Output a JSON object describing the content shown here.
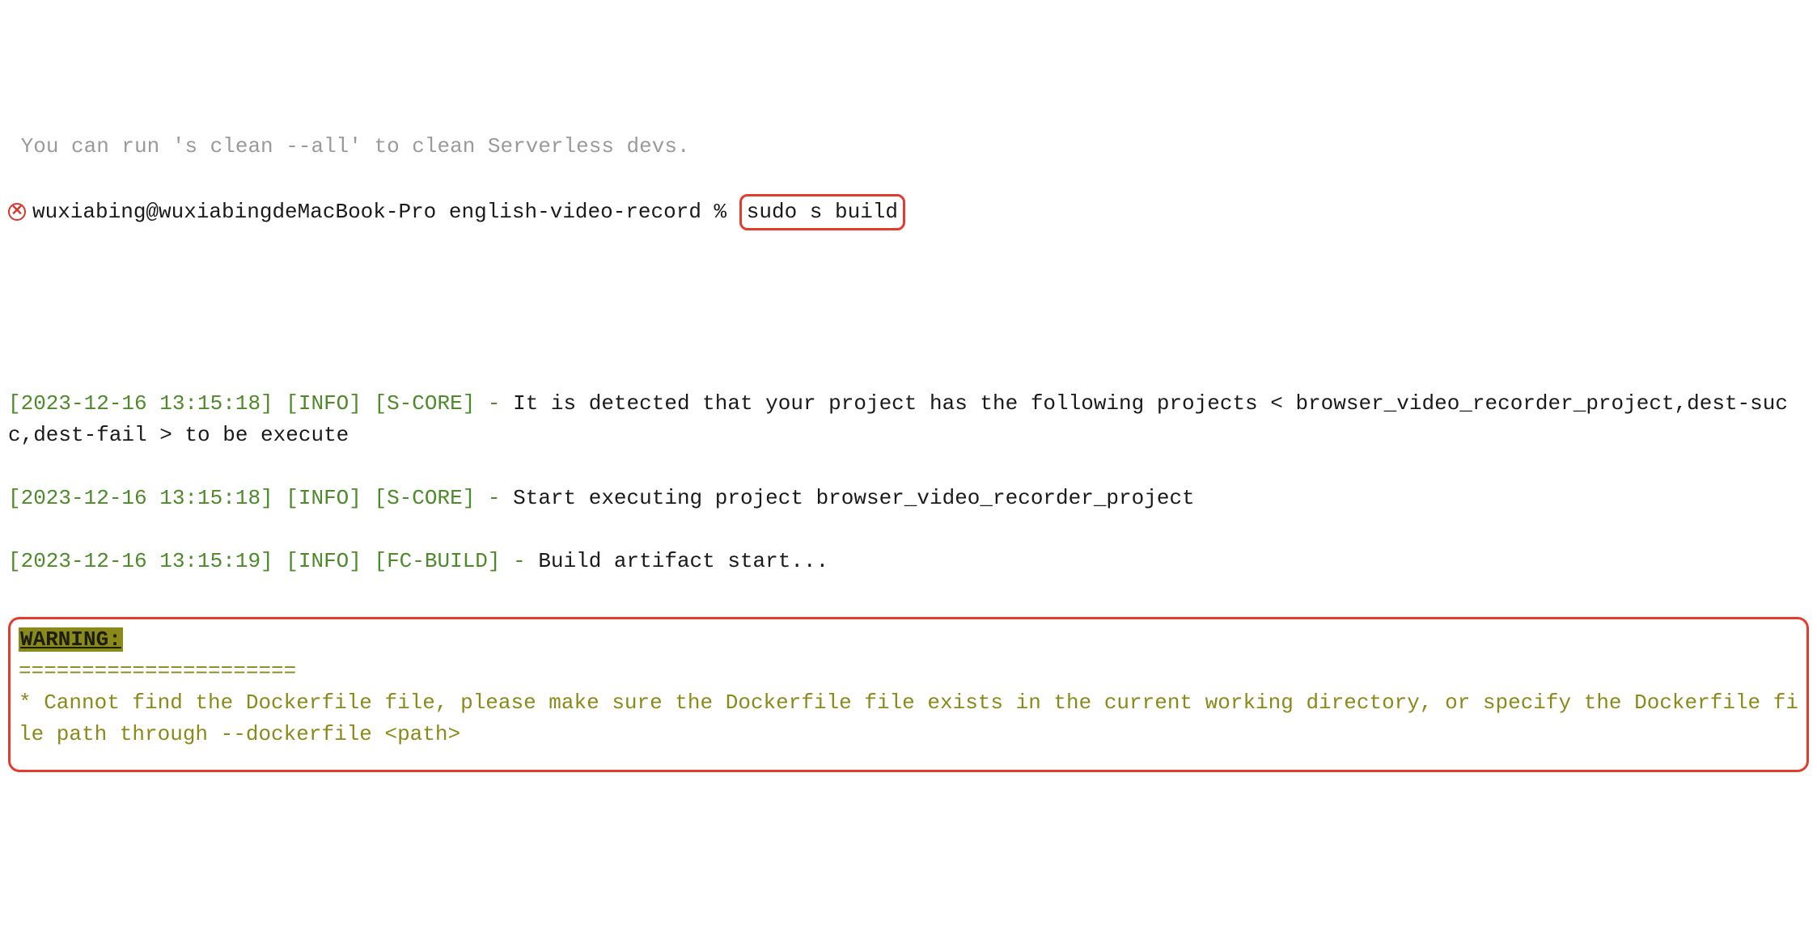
{
  "hint": " You can run 's clean --all' to clean Serverless devs.",
  "close_glyph": "✕",
  "prompt": {
    "user_host": "wuxiabing@wuxiabingdeMacBook-Pro",
    "cwd": "english-video-record",
    "sep": " % ",
    "command": "sudo s build"
  },
  "logs": {
    "l1_meta": "[2023-12-16 13:15:18] [INFO] [S-CORE] - ",
    "l1_msg": "It is detected that your project has the following projects < browser_video_recorder_project,dest-succ,dest-fail > to be execute",
    "l2_meta": "[2023-12-16 13:15:18] [INFO] [S-CORE] - ",
    "l2_msg": "Start executing project browser_video_recorder_project",
    "l3_meta": "[2023-12-16 13:15:19] [INFO] [FC-BUILD] - ",
    "l3_msg": "Build artifact start..."
  },
  "warn": {
    "label": "WARNING:",
    "rule": "======================",
    "message": "* Cannot find the Dockerfile file, please make sure the Dockerfile file exists in the current working directory, or specify the Dockerfile file path through --dockerfile <path>"
  }
}
